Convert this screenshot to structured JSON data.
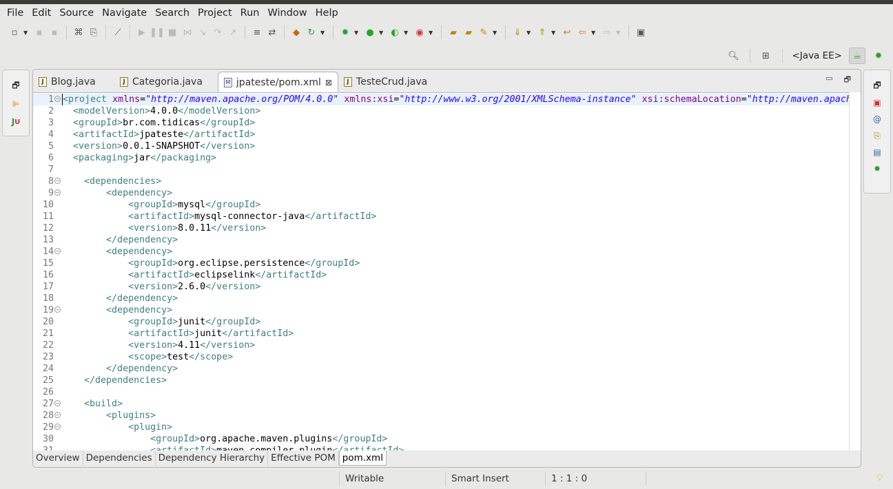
{
  "menu": [
    "File",
    "Edit",
    "Source",
    "Navigate",
    "Search",
    "Project",
    "Run",
    "Window",
    "Help"
  ],
  "perspective": {
    "label": "<Java EE>"
  },
  "tabs": [
    {
      "label": "Blog.java",
      "icon": "java-file-icon"
    },
    {
      "label": "Categoria.java",
      "icon": "java-file-icon"
    },
    {
      "label": "jpateste/pom.xml",
      "icon": "maven-file-icon",
      "active": true
    },
    {
      "label": "TesteCrud.java",
      "icon": "java-file-icon"
    }
  ],
  "code": [
    {
      "n": "1",
      "fold": true,
      "html": [
        [
          "t",
          "<project "
        ],
        [
          "a",
          "xmlns"
        ],
        [
          "c",
          "="
        ],
        [
          "v",
          "\"http://maven.apache.org/POM/4.0.0\""
        ],
        [
          "c",
          " "
        ],
        [
          "a",
          "xmlns:xsi"
        ],
        [
          "c",
          "="
        ],
        [
          "v",
          "\"http://www.w3.org/2001/XMLSchema-instance\""
        ],
        [
          "c",
          " "
        ],
        [
          "a",
          "xsi:schemaLocation"
        ],
        [
          "c",
          "="
        ],
        [
          "v",
          "\"http://maven.apach"
        ]
      ]
    },
    {
      "n": "2",
      "html": [
        [
          "c",
          "  "
        ],
        [
          "t",
          "<modelVersion>"
        ],
        [
          "c",
          "4.0.0"
        ],
        [
          "t",
          "</modelVersion>"
        ]
      ]
    },
    {
      "n": "3",
      "html": [
        [
          "c",
          "  "
        ],
        [
          "t",
          "<groupId>"
        ],
        [
          "c",
          "br.com.tidicas"
        ],
        [
          "t",
          "</groupId>"
        ]
      ]
    },
    {
      "n": "4",
      "html": [
        [
          "c",
          "  "
        ],
        [
          "t",
          "<artifactId>"
        ],
        [
          "c",
          "jpateste"
        ],
        [
          "t",
          "</artifactId>"
        ]
      ]
    },
    {
      "n": "5",
      "html": [
        [
          "c",
          "  "
        ],
        [
          "t",
          "<version>"
        ],
        [
          "c",
          "0.0.1-SNAPSHOT"
        ],
        [
          "t",
          "</version>"
        ]
      ]
    },
    {
      "n": "6",
      "html": [
        [
          "c",
          "  "
        ],
        [
          "t",
          "<packaging>"
        ],
        [
          "c",
          "jar"
        ],
        [
          "t",
          "</packaging>"
        ]
      ]
    },
    {
      "n": "7",
      "html": []
    },
    {
      "n": "8",
      "fold": true,
      "html": [
        [
          "c",
          "    "
        ],
        [
          "t",
          "<dependencies>"
        ]
      ]
    },
    {
      "n": "9",
      "fold": true,
      "html": [
        [
          "c",
          "        "
        ],
        [
          "t",
          "<dependency>"
        ]
      ]
    },
    {
      "n": "10",
      "html": [
        [
          "c",
          "            "
        ],
        [
          "t",
          "<groupId>"
        ],
        [
          "c",
          "mysql"
        ],
        [
          "t",
          "</groupId>"
        ]
      ]
    },
    {
      "n": "11",
      "html": [
        [
          "c",
          "            "
        ],
        [
          "t",
          "<artifactId>"
        ],
        [
          "c",
          "mysql-connector-java"
        ],
        [
          "t",
          "</artifactId>"
        ]
      ]
    },
    {
      "n": "12",
      "html": [
        [
          "c",
          "            "
        ],
        [
          "t",
          "<version>"
        ],
        [
          "c",
          "8.0.11"
        ],
        [
          "t",
          "</version>"
        ]
      ]
    },
    {
      "n": "13",
      "html": [
        [
          "c",
          "        "
        ],
        [
          "t",
          "</dependency>"
        ]
      ]
    },
    {
      "n": "14",
      "fold": true,
      "html": [
        [
          "c",
          "        "
        ],
        [
          "t",
          "<dependency>"
        ]
      ]
    },
    {
      "n": "15",
      "html": [
        [
          "c",
          "            "
        ],
        [
          "t",
          "<groupId>"
        ],
        [
          "c",
          "org.eclipse.persistence"
        ],
        [
          "t",
          "</groupId>"
        ]
      ]
    },
    {
      "n": "16",
      "html": [
        [
          "c",
          "            "
        ],
        [
          "t",
          "<artifactId>"
        ],
        [
          "c",
          "eclipselink"
        ],
        [
          "t",
          "</artifactId>"
        ]
      ]
    },
    {
      "n": "17",
      "html": [
        [
          "c",
          "            "
        ],
        [
          "t",
          "<version>"
        ],
        [
          "c",
          "2.6.0"
        ],
        [
          "t",
          "</version>"
        ]
      ]
    },
    {
      "n": "18",
      "html": [
        [
          "c",
          "        "
        ],
        [
          "t",
          "</dependency>"
        ]
      ]
    },
    {
      "n": "19",
      "fold": true,
      "html": [
        [
          "c",
          "        "
        ],
        [
          "t",
          "<dependency>"
        ]
      ]
    },
    {
      "n": "20",
      "html": [
        [
          "c",
          "            "
        ],
        [
          "t",
          "<groupId>"
        ],
        [
          "c",
          "junit"
        ],
        [
          "t",
          "</groupId>"
        ]
      ]
    },
    {
      "n": "21",
      "html": [
        [
          "c",
          "            "
        ],
        [
          "t",
          "<artifactId>"
        ],
        [
          "c",
          "junit"
        ],
        [
          "t",
          "</artifactId>"
        ]
      ]
    },
    {
      "n": "22",
      "html": [
        [
          "c",
          "            "
        ],
        [
          "t",
          "<version>"
        ],
        [
          "c",
          "4.11"
        ],
        [
          "t",
          "</version>"
        ]
      ]
    },
    {
      "n": "23",
      "html": [
        [
          "c",
          "            "
        ],
        [
          "t",
          "<scope>"
        ],
        [
          "c",
          "test"
        ],
        [
          "t",
          "</scope>"
        ]
      ]
    },
    {
      "n": "24",
      "html": [
        [
          "c",
          "        "
        ],
        [
          "t",
          "</dependency>"
        ]
      ]
    },
    {
      "n": "25",
      "html": [
        [
          "c",
          "    "
        ],
        [
          "t",
          "</dependencies>"
        ]
      ]
    },
    {
      "n": "26",
      "html": []
    },
    {
      "n": "27",
      "fold": true,
      "html": [
        [
          "c",
          "    "
        ],
        [
          "t",
          "<build>"
        ]
      ]
    },
    {
      "n": "28",
      "fold": true,
      "html": [
        [
          "c",
          "        "
        ],
        [
          "t",
          "<plugins>"
        ]
      ]
    },
    {
      "n": "29",
      "fold": true,
      "html": [
        [
          "c",
          "            "
        ],
        [
          "t",
          "<plugin>"
        ]
      ]
    },
    {
      "n": "30",
      "html": [
        [
          "c",
          "                "
        ],
        [
          "t",
          "<groupId>"
        ],
        [
          "c",
          "org.apache.maven.plugins"
        ],
        [
          "t",
          "</groupId>"
        ]
      ]
    },
    {
      "n": "31",
      "html": [
        [
          "c",
          "                "
        ],
        [
          "t",
          "<artifactId>"
        ],
        [
          "c",
          "maven-compiler-plugin"
        ],
        [
          "t",
          "</artifactId>"
        ]
      ]
    }
  ],
  "bottom_tabs": [
    "Overview",
    "Dependencies",
    "Dependency Hierarchy",
    "Effective POM",
    "pom.xml"
  ],
  "status": {
    "writable": "Writable",
    "insert": "Smart Insert",
    "position": "1 : 1 : 0"
  },
  "colors": {
    "tag": "#3f7f7f",
    "attribute": "#7f007f",
    "value": "#2a00ff"
  }
}
